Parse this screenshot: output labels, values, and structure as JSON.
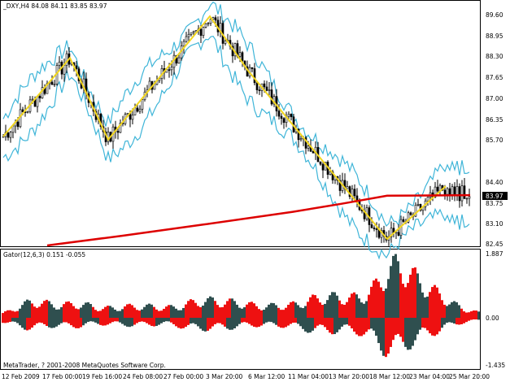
{
  "main_panel": {
    "header": "_DXY,H4  84.08 84.11 83.85 83.97",
    "current_price_label": "83.97",
    "y_ticks": [
      "89.60",
      "88.95",
      "88.30",
      "87.65",
      "87.00",
      "86.35",
      "85.70",
      "84.40",
      "83.75",
      "83.10",
      "82.45"
    ],
    "colors": {
      "candles": "#000000",
      "envelope": "#3fb5d8",
      "zigzag": "#f2d61e",
      "moving_average": "#dd0000",
      "price_box": "#000000"
    }
  },
  "indicator_panel": {
    "header": "Gator(12,6,3) 0.151 -0.055",
    "y_ticks": [
      "1.887",
      "0.00",
      "-1.435"
    ],
    "copyright": "MetaTrader, ? 2001-2008 MetaQuotes Software Corp.",
    "colors": {
      "up": "#ee1111",
      "down": "#2f4f4f"
    }
  },
  "x_axis": {
    "labels": [
      "12 Feb 2009",
      "17 Feb 00:00",
      "19 Feb 16:00",
      "24 Feb 08:00",
      "27 Feb 00:00",
      "3 Mar 20:00",
      "6 Mar 12:00",
      "11 Mar 04:00",
      "13 Mar 20:00",
      "18 Mar 12:00",
      "23 Mar 04:00",
      "25 Mar 20:00"
    ]
  },
  "chart_data": [
    {
      "type": "candlestick",
      "title": "_DXY,H4",
      "ohlc_last": {
        "open": 84.08,
        "high": 84.11,
        "low": 83.85,
        "close": 83.97
      },
      "ylim": [
        82.45,
        89.6
      ],
      "zigzag": [
        {
          "x": "12 Feb 2009",
          "y": 85.8
        },
        {
          "x": "16 Feb",
          "y": 88.25
        },
        {
          "x": "19 Feb 08:00",
          "y": 85.7
        },
        {
          "x": "2 Mar 20:00",
          "y": 89.55
        },
        {
          "x": "6 Mar 08:00",
          "y": 87.85
        },
        {
          "x": "18 Mar 12:00",
          "y": 82.6
        },
        {
          "x": "24 Mar 20:00",
          "y": 84.25
        }
      ],
      "moving_average": [
        {
          "x": "16 Feb",
          "y": 82.4
        },
        {
          "x": "24 Feb",
          "y": 82.7
        },
        {
          "x": "3 Mar",
          "y": 83.05
        },
        {
          "x": "11 Mar",
          "y": 83.45
        },
        {
          "x": "16 Mar",
          "y": 83.7
        },
        {
          "x": "18 Mar",
          "y": 83.95
        },
        {
          "x": "26 Mar",
          "y": 83.97
        }
      ]
    },
    {
      "type": "bar",
      "title": "Gator(12,6,3) 0.151 -0.055",
      "ylim": [
        -1.435,
        1.887
      ],
      "last_values": {
        "upper": 0.151,
        "lower": -0.055
      }
    }
  ]
}
